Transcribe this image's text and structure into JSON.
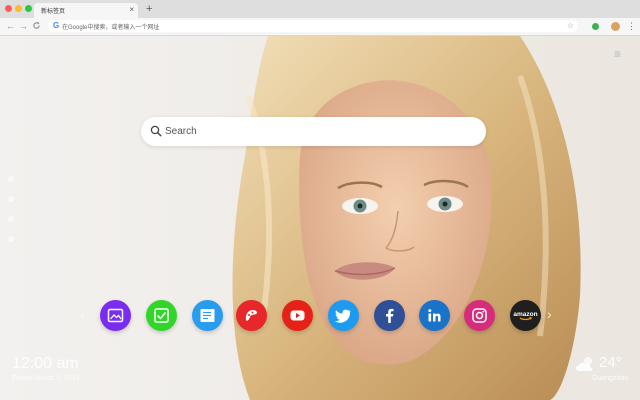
{
  "browser": {
    "tab_title": "新标签页",
    "tab_close": "×",
    "new_tab": "+",
    "nav_back": "←",
    "nav_forward": "→",
    "nav_reload": "C",
    "omnibox_placeholder": "在Google中搜索，或者输入一个网址",
    "star": "☆",
    "menu": "⋮"
  },
  "page": {
    "menu_icon": "≡",
    "search": {
      "placeholder": "Search"
    },
    "carousel": {
      "prev": "‹",
      "next": "›"
    },
    "shortcuts": [
      {
        "name": "photo-editor",
        "icon": "image-icon",
        "color": "#7a2cf0"
      },
      {
        "name": "todo",
        "icon": "checkbox-icon",
        "color": "#32d62b"
      },
      {
        "name": "notes",
        "icon": "notes-icon",
        "color": "#2a9cf0"
      },
      {
        "name": "games",
        "icon": "gamepad-icon",
        "color": "#e8272a"
      },
      {
        "name": "youtube",
        "icon": "play-icon",
        "color": "#e62117"
      },
      {
        "name": "twitter",
        "icon": "bird-icon",
        "color": "#1d9bf0"
      },
      {
        "name": "facebook",
        "icon": "f-icon",
        "color": "#2f4f96"
      },
      {
        "name": "linkedin",
        "icon": "in-icon",
        "color": "#1a73c9"
      },
      {
        "name": "instagram",
        "icon": "camera-icon",
        "color": "#d52d7c"
      },
      {
        "name": "amazon",
        "icon": "amazon-icon",
        "color": "#1f1f1f"
      }
    ],
    "clock": "12:00 am",
    "date": "Friday, March 8, 2019",
    "weather": {
      "temperature": "24°",
      "city": "Guangzhou"
    }
  }
}
